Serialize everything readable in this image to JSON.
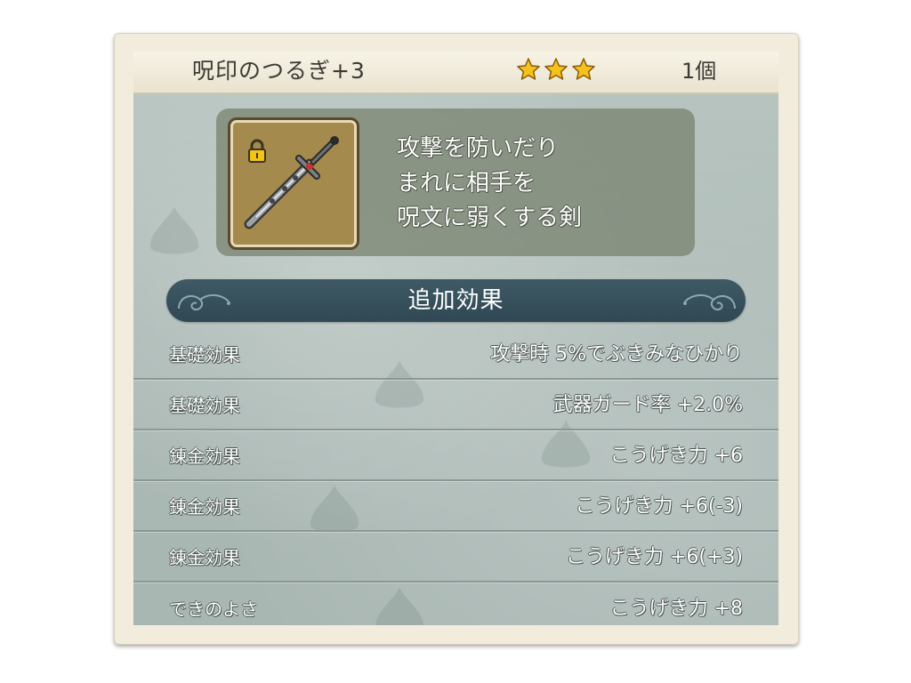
{
  "item": {
    "name": "呪印のつるぎ+3",
    "rarity_stars": 3,
    "quantity": "1個",
    "locked": true,
    "icon": "sword-icon",
    "description": [
      "攻撃を防いだり",
      "まれに相手を",
      "呪文に弱くする剣"
    ]
  },
  "section": {
    "title": "追加効果"
  },
  "effects": [
    {
      "label": "基礎効果",
      "value": "攻撃時 5%でぶきみなひかり"
    },
    {
      "label": "基礎効果",
      "value": "武器ガード率 +2.0%"
    },
    {
      "label": "錬金効果",
      "value": "こうげき力 +6"
    },
    {
      "label": "錬金効果",
      "value": "こうげき力 +6(-3)"
    },
    {
      "label": "錬金効果",
      "value": "こうげき力 +6(+3)"
    },
    {
      "label": "できのよさ",
      "value": "こうげき力 +8"
    }
  ],
  "colors": {
    "star": "#f5c21b",
    "bar": "#34505b",
    "icon_slot": "#a58a4d"
  }
}
